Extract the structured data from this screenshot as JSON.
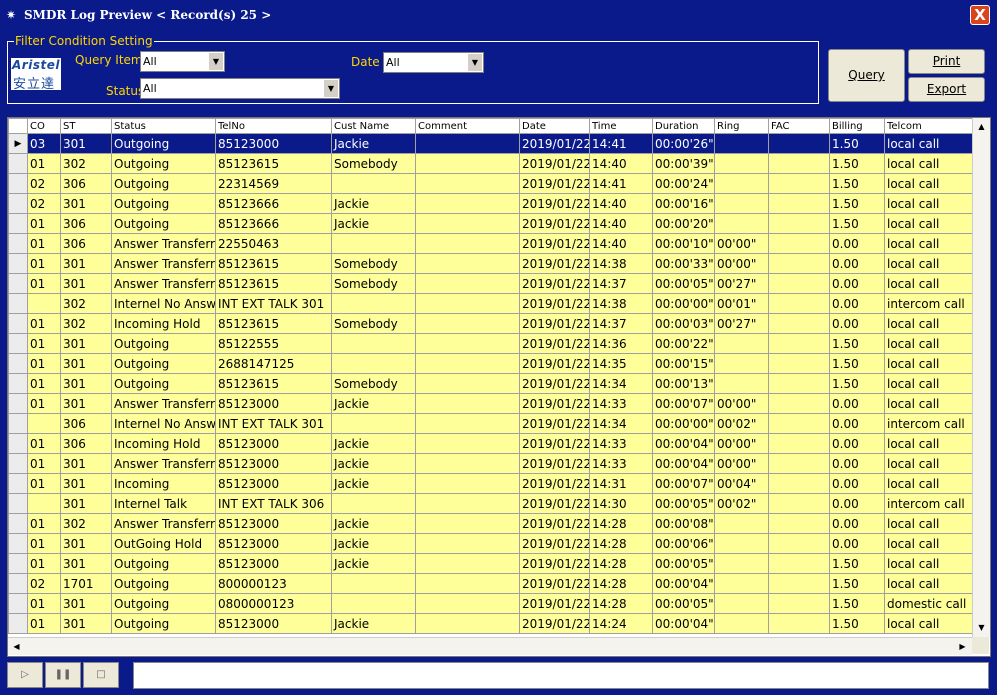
{
  "window": {
    "title": "SMDR Log Preview   < Record(s) 25 >",
    "close_label": "X"
  },
  "filter": {
    "legend": "Filter Condition Setting",
    "logo_text_top": "Aristel",
    "logo_text_bottom": "安立達",
    "query_item_label": "Query Item",
    "query_item_value": "All",
    "date_label": "Date",
    "date_value": "All",
    "status_label": "Status",
    "status_value": "All"
  },
  "buttons": {
    "query": "Query",
    "print": "Print",
    "export": "Export"
  },
  "grid": {
    "columns": [
      "CO",
      "ST",
      "Status",
      "TelNo",
      "Cust Name",
      "Comment",
      "Date",
      "Time",
      "Duration",
      "Ring",
      "FAC",
      "Billing",
      "Telcom"
    ],
    "selected_row": 0,
    "rows": [
      [
        "03",
        "301",
        "Outgoing",
        "85123000",
        "Jackie",
        "",
        "2019/01/22",
        "14:41",
        "00:00'26\"",
        "",
        "",
        "1.50",
        "local call"
      ],
      [
        "01",
        "302",
        "Outgoing",
        "85123615",
        "Somebody",
        "",
        "2019/01/22",
        "14:40",
        "00:00'39\"",
        "",
        "",
        "1.50",
        "local call"
      ],
      [
        "02",
        "306",
        "Outgoing",
        "22314569",
        "",
        "",
        "2019/01/22",
        "14:41",
        "00:00'24\"",
        "",
        "",
        "1.50",
        "local call"
      ],
      [
        "02",
        "301",
        "Outgoing",
        "85123666",
        "Jackie",
        "",
        "2019/01/22",
        "14:40",
        "00:00'16\"",
        "",
        "",
        "1.50",
        "local call"
      ],
      [
        "01",
        "306",
        "Outgoing",
        "85123666",
        "Jackie",
        "",
        "2019/01/22",
        "14:40",
        "00:00'20\"",
        "",
        "",
        "1.50",
        "local call"
      ],
      [
        "01",
        "306",
        "Answer Transferring",
        "22550463",
        "",
        "",
        "2019/01/22",
        "14:40",
        "00:00'10\"",
        "00'00\"",
        "",
        "0.00",
        "local call"
      ],
      [
        "01",
        "301",
        "Answer Transferring",
        "85123615",
        "Somebody",
        "",
        "2019/01/22",
        "14:38",
        "00:00'33\"",
        "00'00\"",
        "",
        "0.00",
        "local call"
      ],
      [
        "01",
        "301",
        "Answer Transferring",
        "85123615",
        "Somebody",
        "",
        "2019/01/22",
        "14:37",
        "00:00'05\"",
        "00'27\"",
        "",
        "0.00",
        "local call"
      ],
      [
        "",
        "302",
        "Internel No Answer",
        "INT EXT TALK  301",
        "",
        "",
        "2019/01/22",
        "14:38",
        "00:00'00\"",
        "00'01\"",
        "",
        "0.00",
        "intercom call"
      ],
      [
        "01",
        "302",
        "Incoming Hold",
        "85123615",
        "Somebody",
        "",
        "2019/01/22",
        "14:37",
        "00:00'03\"",
        "00'27\"",
        "",
        "0.00",
        "local call"
      ],
      [
        "01",
        "301",
        "Outgoing",
        "85122555",
        "",
        "",
        "2019/01/22",
        "14:36",
        "00:00'22\"",
        "",
        "",
        "1.50",
        "local call"
      ],
      [
        "01",
        "301",
        "Outgoing",
        "2688147125",
        "",
        "",
        "2019/01/22",
        "14:35",
        "00:00'15\"",
        "",
        "",
        "1.50",
        "local call"
      ],
      [
        "01",
        "301",
        "Outgoing",
        "85123615",
        "Somebody",
        "",
        "2019/01/22",
        "14:34",
        "00:00'13\"",
        "",
        "",
        "1.50",
        "local call"
      ],
      [
        "01",
        "301",
        "Answer Transferring",
        "85123000",
        "Jackie",
        "",
        "2019/01/22",
        "14:33",
        "00:00'07\"",
        "00'00\"",
        "",
        "0.00",
        "local call"
      ],
      [
        "",
        "306",
        "Internel No Answer",
        "INT EXT TALK  301",
        "",
        "",
        "2019/01/22",
        "14:34",
        "00:00'00\"",
        "00'02\"",
        "",
        "0.00",
        "intercom call"
      ],
      [
        "01",
        "306",
        "Incoming Hold",
        "85123000",
        "Jackie",
        "",
        "2019/01/22",
        "14:33",
        "00:00'04\"",
        "00'00\"",
        "",
        "0.00",
        "local call"
      ],
      [
        "01",
        "301",
        "Answer Transferring",
        "85123000",
        "Jackie",
        "",
        "2019/01/22",
        "14:33",
        "00:00'04\"",
        "00'00\"",
        "",
        "0.00",
        "local call"
      ],
      [
        "01",
        "301",
        "Incoming",
        "85123000",
        "Jackie",
        "",
        "2019/01/22",
        "14:31",
        "00:00'07\"",
        "00'04\"",
        "",
        "0.00",
        "local call"
      ],
      [
        "",
        "301",
        "Internel Talk",
        "INT EXT TALK  306",
        "",
        "",
        "2019/01/22",
        "14:30",
        "00:00'05\"",
        "00'02\"",
        "",
        "0.00",
        "intercom call"
      ],
      [
        "01",
        "302",
        "Answer Transferring",
        "85123000",
        "Jackie",
        "",
        "2019/01/22",
        "14:28",
        "00:00'08\"",
        "",
        "",
        "0.00",
        "local call"
      ],
      [
        "01",
        "301",
        "OutGoing Hold",
        "85123000",
        "Jackie",
        "",
        "2019/01/22",
        "14:28",
        "00:00'06\"",
        "",
        "",
        "0.00",
        "local call"
      ],
      [
        "01",
        "301",
        "Outgoing",
        "85123000",
        "Jackie",
        "",
        "2019/01/22",
        "14:28",
        "00:00'05\"",
        "",
        "",
        "1.50",
        "local call"
      ],
      [
        "02",
        "1701",
        "Outgoing",
        "800000123",
        "",
        "",
        "2019/01/22",
        "14:28",
        "00:00'04\"",
        "",
        "",
        "1.50",
        "local call"
      ],
      [
        "01",
        "301",
        "Outgoing",
        "0800000123",
        "",
        "",
        "2019/01/22",
        "14:28",
        "00:00'05\"",
        "",
        "",
        "1.50",
        "domestic call"
      ],
      [
        "01",
        "301",
        "Outgoing",
        "85123000",
        "Jackie",
        "",
        "2019/01/22",
        "14:24",
        "00:00'04\"",
        "",
        "",
        "1.50",
        "local call"
      ]
    ]
  },
  "playback": {
    "play_icon": "play-icon",
    "pause_icon": "pause-icon",
    "stop_icon": "stop-icon"
  },
  "status_text": ""
}
